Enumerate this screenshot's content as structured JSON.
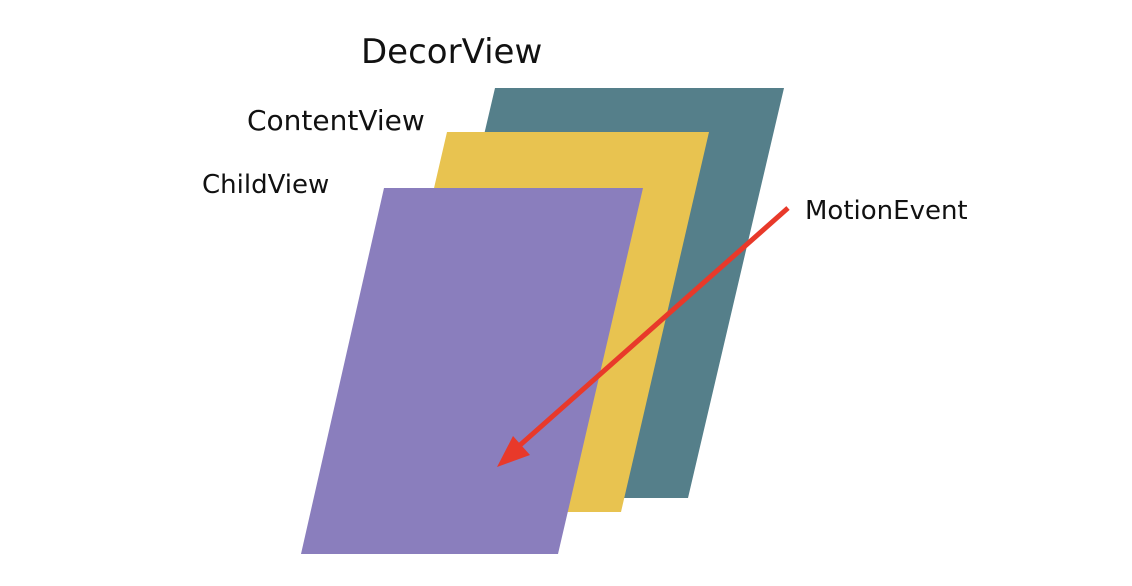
{
  "layers": [
    {
      "id": "decor",
      "label": "DecorView",
      "color": "#557f8a"
    },
    {
      "id": "content",
      "label": "ContentView",
      "color": "#e8c350"
    },
    {
      "id": "child",
      "label": "ChildView",
      "color": "#8a7ebd"
    }
  ],
  "event": {
    "label": "MotionEvent",
    "arrow_color": "#e8392a"
  }
}
